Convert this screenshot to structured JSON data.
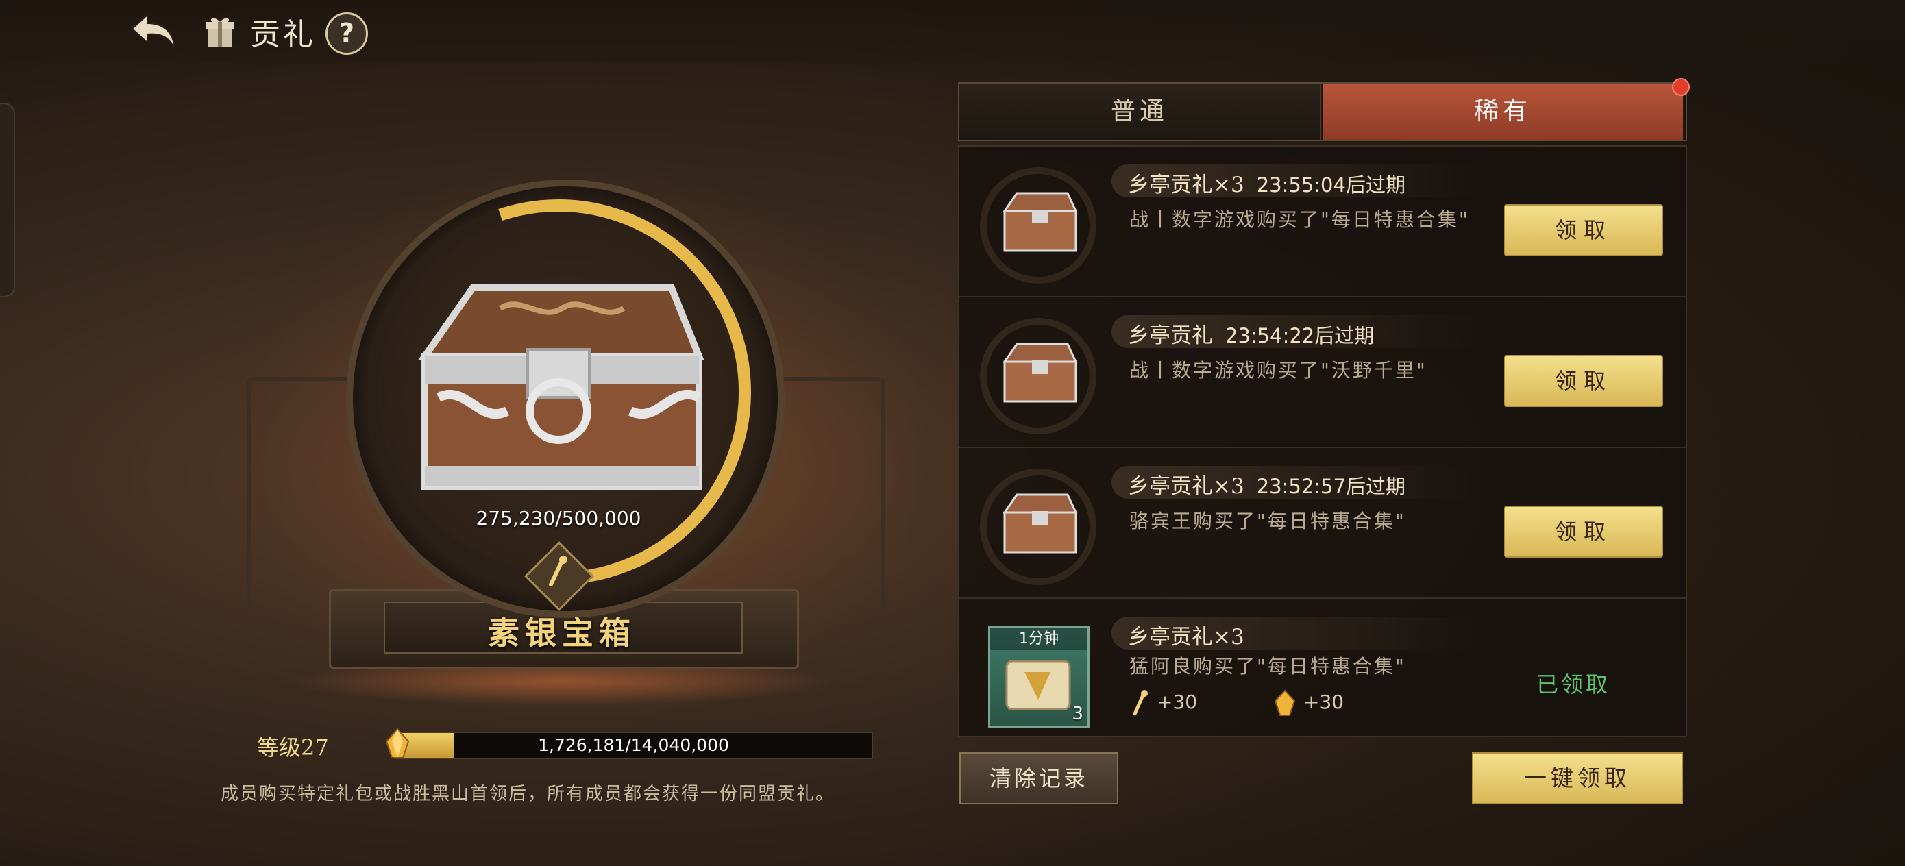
{
  "header": {
    "title": "贡礼",
    "help_label": "?"
  },
  "chest": {
    "name": "素银宝箱",
    "progress_text": "275,230/500,000",
    "progress_value": 275230,
    "progress_max": 500000
  },
  "level": {
    "label": "等级27",
    "progress_text": "1,726,181/14,040,000",
    "progress_value": 1726181,
    "progress_max": 14040000
  },
  "description": "成员购买特定礼包或战胜黑山首领后，所有成员都会获得一份同盟贡礼。",
  "tabs": [
    {
      "label": "普通",
      "active": false
    },
    {
      "label": "稀有",
      "active": true
    }
  ],
  "rows": [
    {
      "title": "乡亭贡礼×3",
      "expire": "23:55:04后过期",
      "desc": "战丨数字游戏购买了\"每日特惠合集\"",
      "button": "领取"
    },
    {
      "title": "乡亭贡礼",
      "expire": "23:54:22后过期",
      "desc": "战丨数字游戏购买了\"沃野千里\"",
      "button": "领取"
    },
    {
      "title": "乡亭贡礼×3",
      "expire": "23:52:57后过期",
      "desc": "骆宾王购买了\"每日特惠合集\"",
      "button": "领取"
    },
    {
      "title": "乡亭贡礼×3",
      "expire": "",
      "desc": "猛阿良购买了\"每日特惠合集\"",
      "status": "已领取",
      "item_label": "1分钟",
      "item_count": "3",
      "rewards": [
        {
          "icon": "key-icon",
          "value": "+30"
        },
        {
          "icon": "gem-icon",
          "value": "+30"
        }
      ]
    }
  ],
  "footer": {
    "clear_label": "清除记录",
    "claim_all_label": "一键领取"
  },
  "colors": {
    "accent_gold": "#f3df8c",
    "tab_active": "#b8563a",
    "claimed_green": "#5ec36a"
  }
}
